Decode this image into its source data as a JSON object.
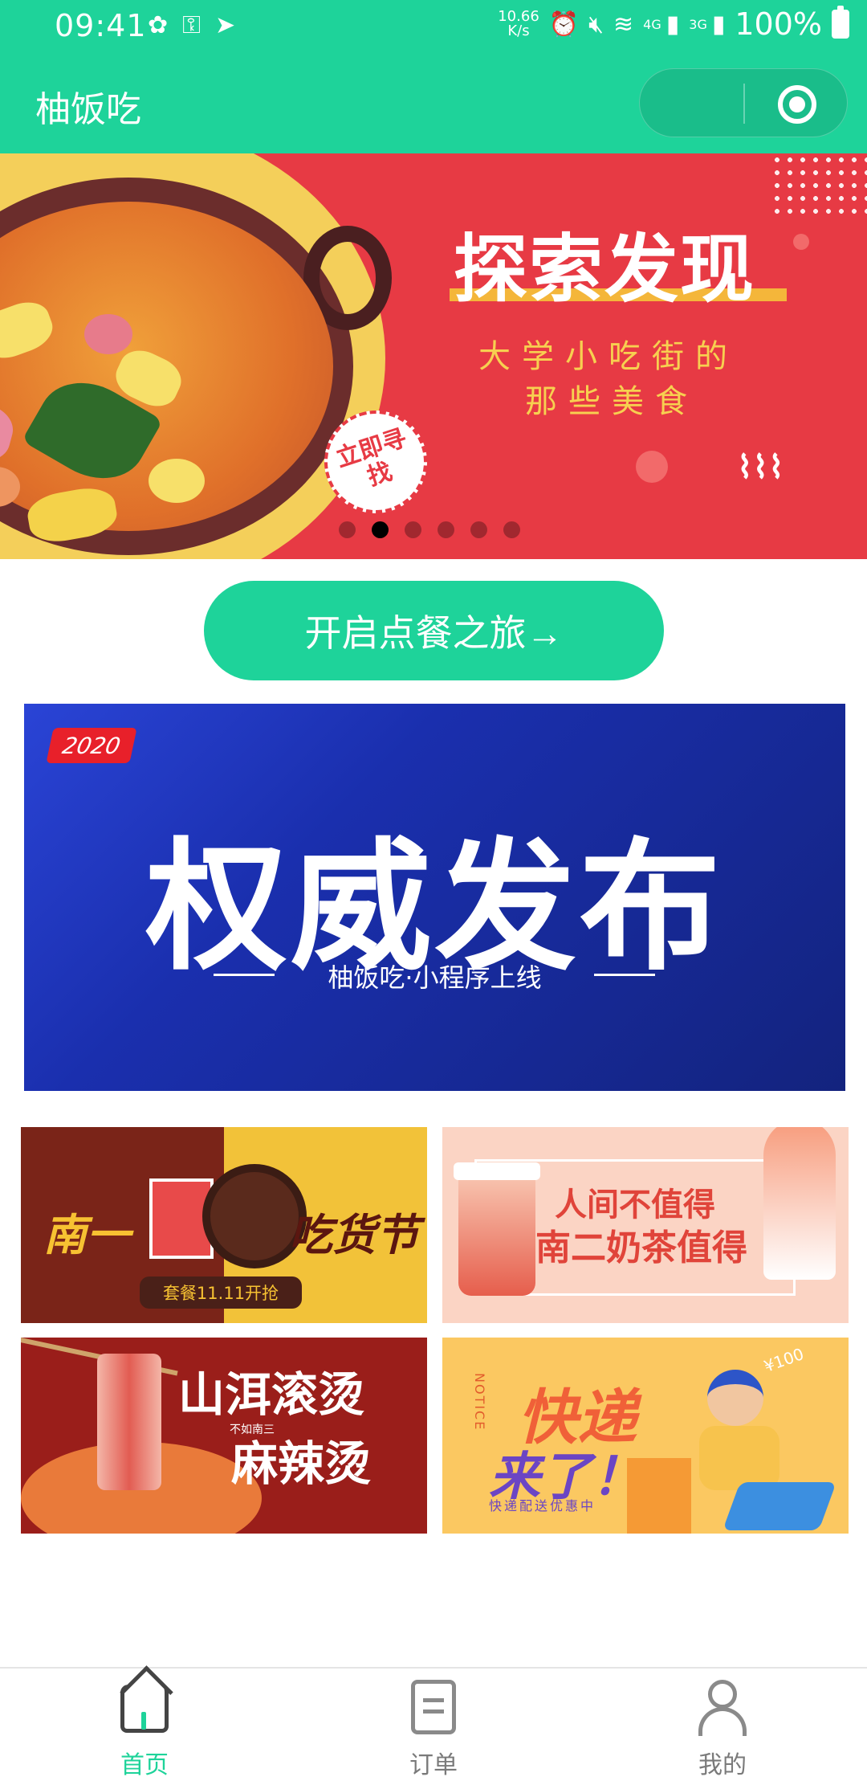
{
  "status_bar": {
    "time": "09:41",
    "speed": "10.66\nK/s",
    "signal_4g": "4G",
    "signal_3g": "3G",
    "battery": "100%",
    "icons_left": [
      "wechat-icon",
      "key-icon",
      "send-icon"
    ],
    "icons_right": [
      "alarm-icon",
      "mute-icon",
      "wifi-icon",
      "signal-icon",
      "battery-icon"
    ]
  },
  "nav": {
    "title": "柚饭吃",
    "capsule_icons": [
      "more-icon",
      "close-target-icon"
    ]
  },
  "hero": {
    "title": "探索发现",
    "sub_line1": "大学小吃街的",
    "sub_line2": "那些美食",
    "stamp": "立即寻找",
    "slide_count": 6,
    "active_slide": 2
  },
  "cta": {
    "label": "开启点餐之旅→"
  },
  "announcement": {
    "year": "2020",
    "title": "权威发布",
    "subtitle": "柚饭吃·小程序上线"
  },
  "promos": [
    {
      "left": "南一",
      "right": "吃货节",
      "pill": "套餐11.11开抢"
    },
    {
      "line1": "人间不值得",
      "line2": "南二奶茶值得"
    },
    {
      "line1": "山洱滚烫",
      "line2": "麻辣烫",
      "small": "不如南三"
    },
    {
      "line1": "快递",
      "line2": "来了！",
      "notice": "NOTICE",
      "small": "快递配送优惠中",
      "price": "¥100"
    }
  ],
  "tabbar": {
    "tabs": [
      {
        "label": "首页",
        "icon": "home-icon",
        "active": true
      },
      {
        "label": "订单",
        "icon": "order-icon",
        "active": false
      },
      {
        "label": "我的",
        "icon": "profile-icon",
        "active": false
      }
    ]
  },
  "colors": {
    "brand_green": "#1ed39a",
    "hero_red": "#e73a44",
    "announcement_blue": "#13237e"
  }
}
